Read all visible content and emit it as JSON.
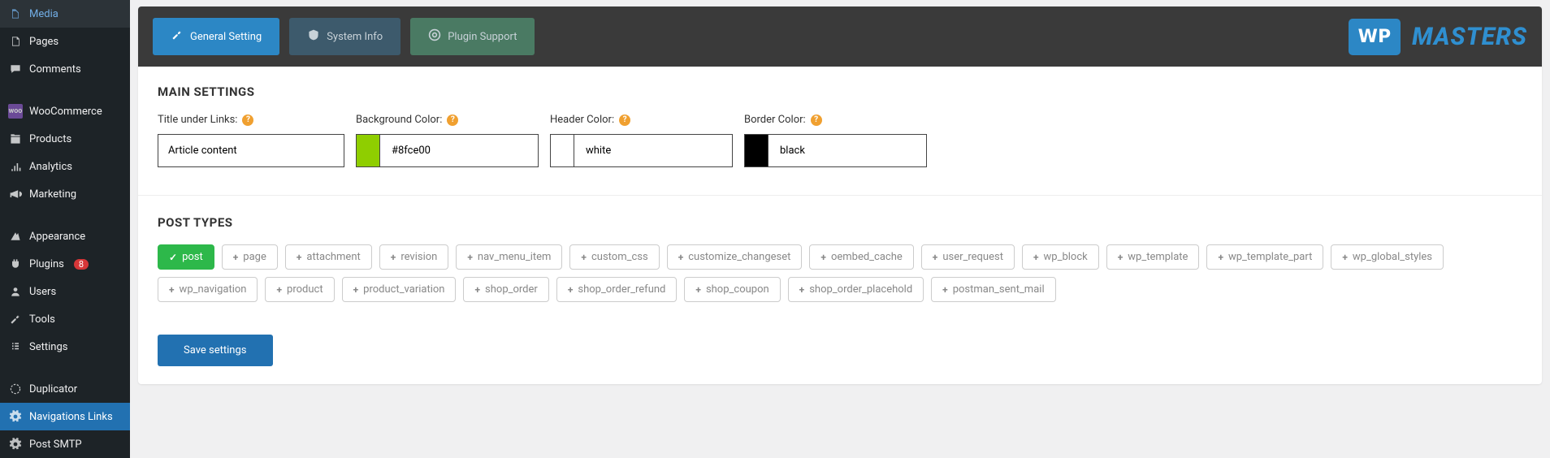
{
  "sidebar": {
    "items": [
      {
        "label": "Media"
      },
      {
        "label": "Pages"
      },
      {
        "label": "Comments"
      },
      {
        "label": "WooCommerce"
      },
      {
        "label": "Products"
      },
      {
        "label": "Analytics"
      },
      {
        "label": "Marketing"
      },
      {
        "label": "Appearance"
      },
      {
        "label": "Plugins",
        "badge": "8"
      },
      {
        "label": "Users"
      },
      {
        "label": "Tools"
      },
      {
        "label": "Settings"
      },
      {
        "label": "Duplicator"
      },
      {
        "label": "Navigations Links"
      },
      {
        "label": "Post SMTP"
      }
    ]
  },
  "header": {
    "tabs": {
      "general": "General Setting",
      "system": "System Info",
      "support": "Plugin Support"
    },
    "logo_box": "WP",
    "logo_text": "MASTERS"
  },
  "main_settings": {
    "title": "MAIN SETTINGS",
    "title_under_links": {
      "label": "Title under Links:",
      "value": "Article content"
    },
    "background_color": {
      "label": "Background Color:",
      "value": "#8fce00",
      "swatch": "#8fce00"
    },
    "header_color": {
      "label": "Header Color:",
      "value": "white",
      "swatch": "#ffffff"
    },
    "border_color": {
      "label": "Border Color:",
      "value": "black",
      "swatch": "#000000"
    }
  },
  "post_types": {
    "title": "POST TYPES",
    "tags": [
      {
        "label": "post",
        "active": true
      },
      {
        "label": "page"
      },
      {
        "label": "attachment"
      },
      {
        "label": "revision"
      },
      {
        "label": "nav_menu_item"
      },
      {
        "label": "custom_css"
      },
      {
        "label": "customize_changeset"
      },
      {
        "label": "oembed_cache"
      },
      {
        "label": "user_request"
      },
      {
        "label": "wp_block"
      },
      {
        "label": "wp_template"
      },
      {
        "label": "wp_template_part"
      },
      {
        "label": "wp_global_styles"
      },
      {
        "label": "wp_navigation"
      },
      {
        "label": "product"
      },
      {
        "label": "product_variation"
      },
      {
        "label": "shop_order"
      },
      {
        "label": "shop_order_refund"
      },
      {
        "label": "shop_coupon"
      },
      {
        "label": "shop_order_placehold"
      },
      {
        "label": "postman_sent_mail"
      }
    ]
  },
  "footer": {
    "save": "Save settings"
  }
}
